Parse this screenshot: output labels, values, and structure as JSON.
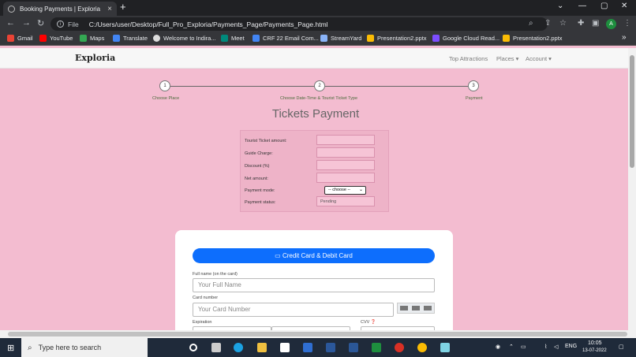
{
  "browser": {
    "tab_title": "Booking Payments | Exploria",
    "tab_close": "×",
    "new_tab": "+",
    "file_label": "File",
    "url": "C:/Users/user/Desktop/Full_Pro_Exploria/Payments_Page/Payments_Page.html",
    "profile_initial": "A",
    "bookmarks": [
      "Gmail",
      "YouTube",
      "Maps",
      "Translate",
      "Welcome to Indira...",
      "Meet",
      "CRF 22 Email Com...",
      "StreamYard",
      "Presentation2.pptx",
      "Google Cloud Read...",
      "Presentation2.pptx"
    ],
    "bookmark_more": "»"
  },
  "navbar": {
    "brand": "Exploria",
    "links": [
      "Top Attractions",
      "Places ▾",
      "Account ▾"
    ]
  },
  "stepper": {
    "steps": [
      {
        "num": "1",
        "label": "Choose Place"
      },
      {
        "num": "2",
        "label": "Choose Date-Time & Tourist Ticket Type"
      },
      {
        "num": "3",
        "label": "Payment"
      }
    ]
  },
  "page_title": "Tickets Payment",
  "summary": {
    "rows": [
      {
        "label": "Tourist Ticket amount:",
        "value": ""
      },
      {
        "label": "Guide Charge:",
        "value": ""
      },
      {
        "label": "Discount (%)",
        "value": ""
      },
      {
        "label": "Net amount:",
        "value": ""
      }
    ],
    "mode_label": "Payment mode:",
    "mode_value": "-- choose --",
    "status_label": "Payment status:",
    "status_value": "Pending"
  },
  "payment_card": {
    "tab_label": "Credit Card & Debit Card",
    "name_label": "Full name (on the card)",
    "name_placeholder": "Your Full Name",
    "number_label": "Card number",
    "number_placeholder": "Your Card Number",
    "expiry_label": "Expiration",
    "cvv_label": "CVV"
  },
  "taskbar": {
    "search_placeholder": "Type here to search",
    "lang": "ENG",
    "time": "10:05",
    "date": "13-07-2022"
  },
  "colors": {
    "page_bg": "#f3bcd0",
    "accent": "#0d6efd",
    "chrome_dark": "#202124"
  }
}
